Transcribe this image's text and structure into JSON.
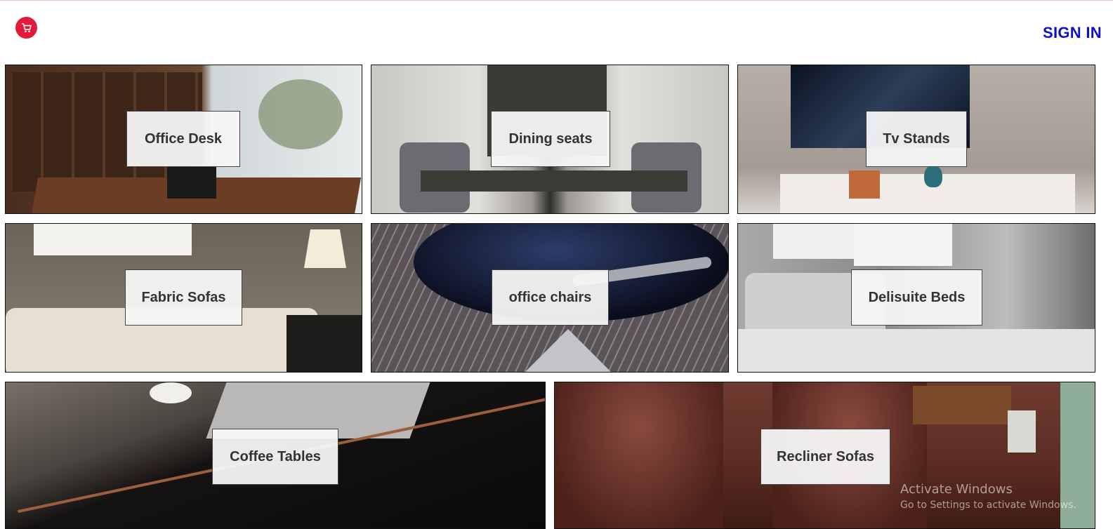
{
  "header": {
    "cart_icon": "shopping-cart-icon",
    "sign_in_label": "SIGN IN"
  },
  "colors": {
    "cart_bg": "#e21b3c",
    "sign_in": "#1010cc"
  },
  "categories": [
    {
      "label": "Office Desk"
    },
    {
      "label": "Dining seats"
    },
    {
      "label": "Tv Stands"
    },
    {
      "label": "Fabric Sofas"
    },
    {
      "label": "office chairs"
    },
    {
      "label": "Delisuite Beds"
    },
    {
      "label": "Coffee Tables"
    },
    {
      "label": "Recliner Sofas"
    }
  ],
  "watermark": {
    "title": "Activate Windows",
    "subtitle": "Go to Settings to activate Windows."
  }
}
